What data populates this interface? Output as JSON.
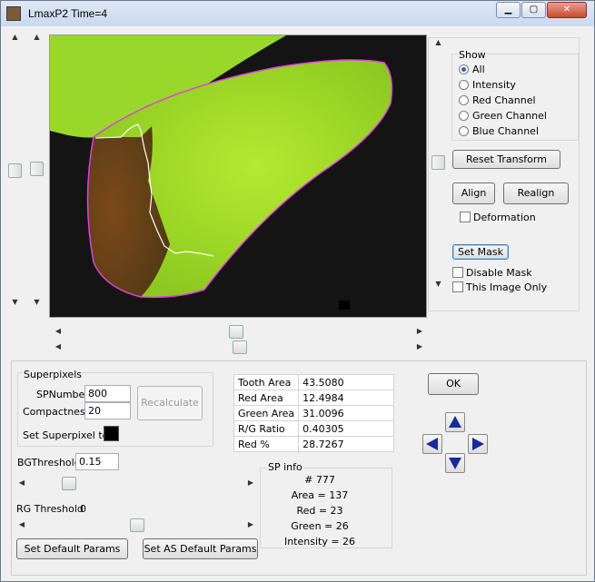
{
  "window": {
    "title": "LmaxP2 Time=4",
    "controls": {
      "minimize": "▁",
      "maximize": "▢",
      "close": "✕"
    }
  },
  "show_panel": {
    "title": "Show",
    "options": [
      "All",
      "Intensity",
      "Red Channel",
      "Green Channel",
      "Blue Channel"
    ],
    "selected": "All"
  },
  "buttons": {
    "reset_transform": "Reset Transform",
    "align": "Align",
    "realign": "Realign",
    "set_mask": "Set Mask",
    "recalculate": "Recalculate",
    "ok": "OK",
    "set_default": "Set Default Params",
    "set_as_default": "Set AS Default Params"
  },
  "checkboxes": {
    "deformation": "Deformation",
    "disable_mask": "Disable Mask",
    "this_image_only": "This Image Only"
  },
  "superpixels": {
    "title": "Superpixels",
    "sp_number_label": "SPNumber",
    "sp_number_value": "800",
    "compactness_label": "Compactness",
    "compactness_value": "20",
    "set_superpixel_label": "Set Superpixel to",
    "swatch_color": "#000000"
  },
  "bg_threshold": {
    "label": "BGThreshold",
    "value": "0.15"
  },
  "rg_threshold": {
    "label": "RG Threshold",
    "value": "0"
  },
  "stats": [
    {
      "label": "Tooth Area",
      "value": "43.5080"
    },
    {
      "label": "Red Area",
      "value": "12.4984"
    },
    {
      "label": "Green Area",
      "value": "31.0096"
    },
    {
      "label": "R/G Ratio",
      "value": "0.40305"
    },
    {
      "label": "Red %",
      "value": "28.7267"
    }
  ],
  "sp_info": {
    "title": "SP info",
    "lines": [
      "# 777",
      "Area = 137",
      "Red = 23",
      "Green = 26",
      "Intensity = 26"
    ]
  },
  "colors": {
    "mask_outline": "#e040e0",
    "region_outline": "#ffffff",
    "tooth_green": "#a8e030",
    "tooth_red": "#8a3a18",
    "nav_arrow": "#1a2a9a"
  },
  "icons": {
    "nav": [
      "arrow-up-icon",
      "arrow-left-icon",
      "arrow-right-icon",
      "arrow-down-icon"
    ]
  }
}
